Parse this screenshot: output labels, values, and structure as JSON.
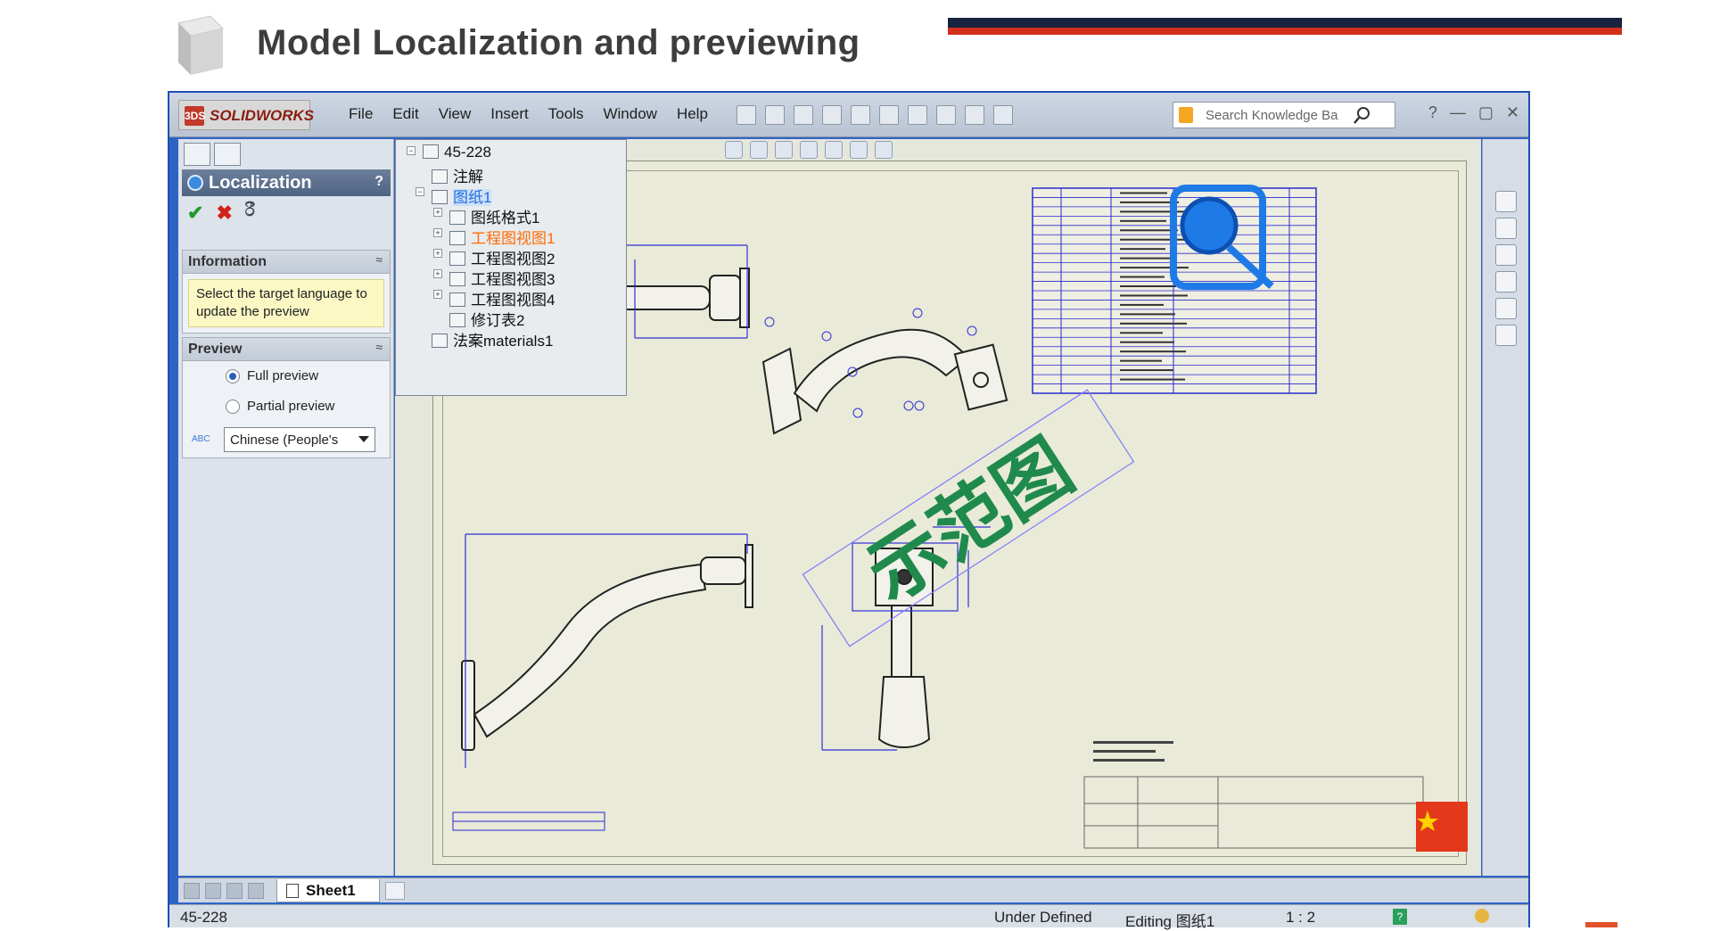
{
  "slide": {
    "title": "Model Localization and previewing"
  },
  "app": {
    "logo_text": "SOLIDWORKS",
    "logo_mark": "3DS",
    "menu": [
      "File",
      "Edit",
      "View",
      "Insert",
      "Tools",
      "Window",
      "Help"
    ],
    "search_placeholder": "Search Knowledge Ba",
    "window_controls": [
      "?",
      "—",
      "▢",
      "✕"
    ]
  },
  "property_manager": {
    "title": "Localization",
    "help": "?",
    "ok": "✔",
    "cancel": "✖",
    "extra": "රී",
    "information": {
      "header": "Information",
      "text": "Select the target language to update the preview"
    },
    "preview": {
      "header": "Preview",
      "full": "Full preview",
      "partial": "Partial preview",
      "abc": "ABC",
      "language": "Chinese (People's"
    },
    "collapse": "≈"
  },
  "tree": {
    "root": "45-228",
    "items": [
      {
        "label": "注解"
      },
      {
        "label": "图纸1"
      },
      {
        "label": "图纸格式1"
      },
      {
        "label": "工程图视图1"
      },
      {
        "label": "工程图视图2"
      },
      {
        "label": "工程图视图3"
      },
      {
        "label": "工程图视图4"
      },
      {
        "label": "修订表2"
      },
      {
        "label": "法案materials1"
      }
    ]
  },
  "drawing": {
    "watermark": "示范图",
    "bom_rows": 22,
    "colors": {
      "watermark": "#1f8a4c",
      "dim_line": "#3030d8",
      "bom": "#2a2ad0",
      "search_ring": "#1e7ae6"
    }
  },
  "tabs": {
    "sheet": "Sheet1"
  },
  "status": {
    "doc": "45-228",
    "state": "Under Defined",
    "editing": "Editing 图纸1",
    "scale": "1 : 2",
    "help": "?"
  }
}
